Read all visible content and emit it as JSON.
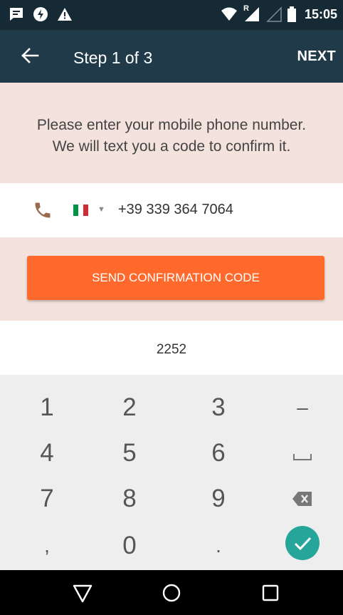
{
  "status_bar": {
    "time": "15:05",
    "roaming": "R"
  },
  "app_bar": {
    "title": "Step 1 of 3",
    "next_label": "NEXT"
  },
  "instructions": {
    "line1": "Please enter your mobile phone number.",
    "line2": "We will text you a code to confirm it."
  },
  "phone": {
    "number": "+39 339 364 7064",
    "flag_colors": [
      "#009246",
      "#ffffff",
      "#ce2b37"
    ],
    "dropdown_glyph": "▼"
  },
  "send": {
    "label": "SEND CONFIRMATION CODE",
    "color": "#ff6a2c"
  },
  "code": {
    "value": "2252"
  },
  "keypad": {
    "keys": [
      "1",
      "2",
      "3",
      "–",
      "4",
      "5",
      "6",
      "",
      "7",
      "8",
      "9",
      "",
      ",",
      "0",
      ".",
      ""
    ],
    "confirm_color": "#26a69a"
  }
}
